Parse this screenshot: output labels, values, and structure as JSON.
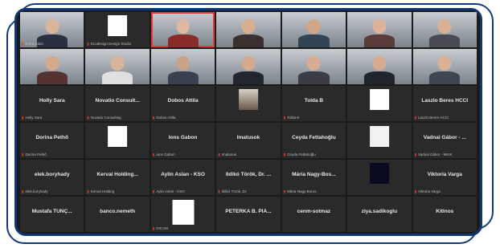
{
  "screen": {
    "rows": [
      [
        {
          "kind": "video",
          "tag": "Emre Cakir",
          "skin": "#d9b59a",
          "shirt": "#2a3040"
        },
        {
          "kind": "logo",
          "logo": "white",
          "tag": "Ecodesign Design Studio"
        },
        {
          "kind": "video",
          "active": true,
          "tag": "",
          "skin": "#e0b8a0",
          "shirt": "#8a2a2a"
        },
        {
          "kind": "video",
          "tag": "",
          "skin": "#d6ae90",
          "shirt": "#3a3030"
        },
        {
          "kind": "video",
          "tag": "",
          "skin": "#cfa68a",
          "shirt": "#334455"
        },
        {
          "kind": "video",
          "tag": "",
          "skin": "#dcb39a",
          "shirt": "#5a3a3a"
        },
        {
          "kind": "video",
          "tag": "",
          "skin": "#d8b094",
          "shirt": "#4a4a55"
        }
      ],
      [
        {
          "kind": "video",
          "tag": "",
          "skin": "#d5a98c",
          "shirt": "#553333"
        },
        {
          "kind": "video",
          "tag": "",
          "skin": "#d8b49a",
          "shirt": "#e0e0e0"
        },
        {
          "kind": "video",
          "tag": "",
          "skin": "#c9a287",
          "shirt": "#3a4050"
        },
        {
          "kind": "video",
          "tag": "",
          "skin": "#d3aa8e",
          "shirt": "#22262e"
        },
        {
          "kind": "video",
          "tag": "",
          "skin": "#d6ad92",
          "shirt": "#3c3c44"
        },
        {
          "kind": "video",
          "tag": "",
          "skin": "#d4ab90",
          "shirt": "#20242c"
        },
        {
          "kind": "video",
          "tag": "",
          "skin": "#d8b196",
          "shirt": "#404650"
        }
      ],
      [
        {
          "kind": "name",
          "name": "Holly Sara",
          "tag": "Holly Sara"
        },
        {
          "kind": "name",
          "name": "Novatio Consult...",
          "tag": "Novatio Consulting"
        },
        {
          "kind": "name",
          "name": "Dobos Attila",
          "tag": "Dobos Attila"
        },
        {
          "kind": "logo",
          "logo": "photo",
          "tag": ""
        },
        {
          "kind": "name",
          "name": "Tolda B",
          "tag": "Tolda B"
        },
        {
          "kind": "logo",
          "logo": "white",
          "tag": ""
        },
        {
          "kind": "name",
          "name": "Laszlo Beres HCCI",
          "tag": "Laszlo Beres HCCI"
        }
      ],
      [
        {
          "kind": "name",
          "name": "Dorina Pethő",
          "tag": "Dorina Pethő"
        },
        {
          "kind": "logo",
          "logo": "white",
          "tag": ""
        },
        {
          "kind": "name",
          "name": "Ions Gabon",
          "tag": "Ions Gabon"
        },
        {
          "kind": "name",
          "name": "Imatusok",
          "tag": "Imatusok"
        },
        {
          "kind": "name",
          "name": "Ceyda Fettahoğlu",
          "tag": "Ceyda Fettahoğlu"
        },
        {
          "kind": "logo",
          "logo": "card",
          "tag": ""
        },
        {
          "kind": "name",
          "name": "Vadnai Gábor - ...",
          "tag": "Vadnai Gábor - MKIK"
        }
      ],
      [
        {
          "kind": "name",
          "name": "elek.boryhady",
          "tag": "elek.boryhady"
        },
        {
          "kind": "name",
          "name": "Kerval Holding...",
          "tag": "Kerval Holding"
        },
        {
          "kind": "name",
          "name": "Aylin Aslan - KSO",
          "tag": "Aylin Aslan - KSO"
        },
        {
          "kind": "name",
          "name": "Ildikó Török, Dr. ...",
          "tag": "Ildikó Török, Dr."
        },
        {
          "kind": "name",
          "name": "Mária Nagy-Bos...",
          "tag": "Mária Nagy-Boros"
        },
        {
          "kind": "logo",
          "logo": "dark",
          "tag": ""
        },
        {
          "kind": "name",
          "name": "Viktoria Varga",
          "tag": "Viktoria Varga"
        }
      ],
      [
        {
          "kind": "name",
          "name": "Mustafa TUNÇ...",
          "tag": ""
        },
        {
          "kind": "name",
          "name": "banco.nemeth",
          "tag": ""
        },
        {
          "kind": "logo",
          "logo": "blue",
          "tag": "DICAM"
        },
        {
          "kind": "name",
          "name": "PETERKA B. PIÁ...",
          "tag": ""
        },
        {
          "kind": "name",
          "name": "cenm-sotmaz",
          "tag": ""
        },
        {
          "kind": "name",
          "name": "ziya.sadikoglu",
          "tag": ""
        },
        {
          "kind": "name",
          "name": "Kitinos",
          "tag": ""
        }
      ]
    ]
  }
}
